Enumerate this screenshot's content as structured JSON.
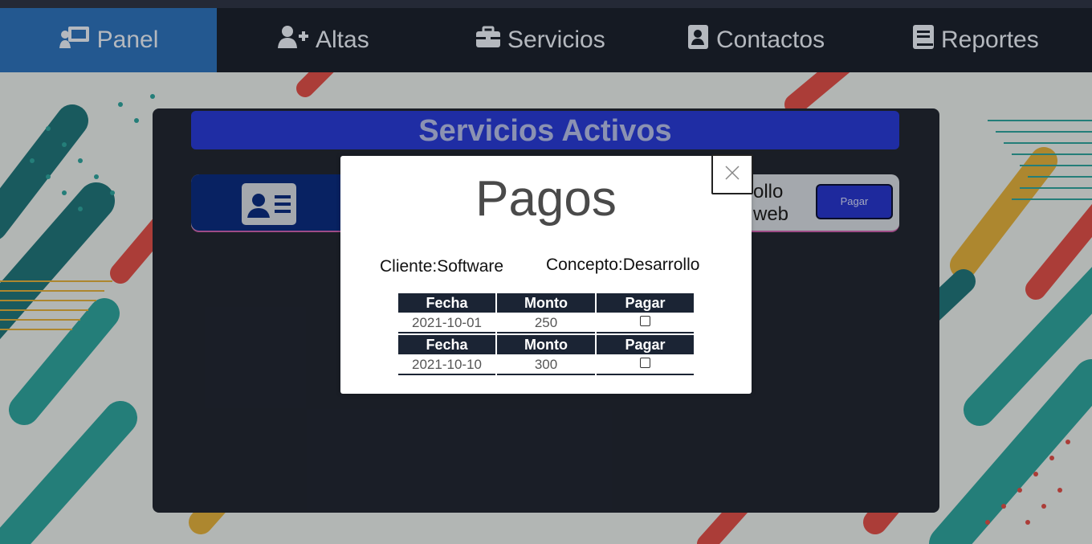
{
  "nav": {
    "items": [
      {
        "label": "Panel",
        "icon": "chalkboard-user-icon",
        "active": true
      },
      {
        "label": "Altas",
        "icon": "user-plus-icon",
        "active": false
      },
      {
        "label": "Servicios",
        "icon": "toolbox-icon",
        "active": false
      },
      {
        "label": "Contactos",
        "icon": "address-book-icon",
        "active": false
      },
      {
        "label": "Reportes",
        "icon": "book-icon",
        "active": false
      }
    ]
  },
  "panel": {
    "title": "Servicios Activos",
    "card": {
      "icon": "id-card-icon",
      "text_line1": "ollo",
      "text_line2": "web",
      "button_label": "Pagar"
    }
  },
  "modal": {
    "title": "Pagos",
    "close_icon": "close-icon",
    "cliente": "Cliente:Software",
    "concepto": "Concepto:Desarrollo",
    "payments": [
      {
        "header": [
          "Fecha",
          "Monto",
          "Pagar"
        ],
        "fecha": "2021-10-01",
        "monto": "250"
      },
      {
        "header": [
          "Fecha",
          "Monto",
          "Pagar"
        ],
        "fecha": "2021-10-10",
        "monto": "300"
      }
    ]
  },
  "colors": {
    "nav_bg": "#1a202b",
    "nav_active": "#2b6cb0",
    "title_bar": "#2738c9",
    "panel_bg": "#20252f",
    "table_header": "#1b2434"
  }
}
